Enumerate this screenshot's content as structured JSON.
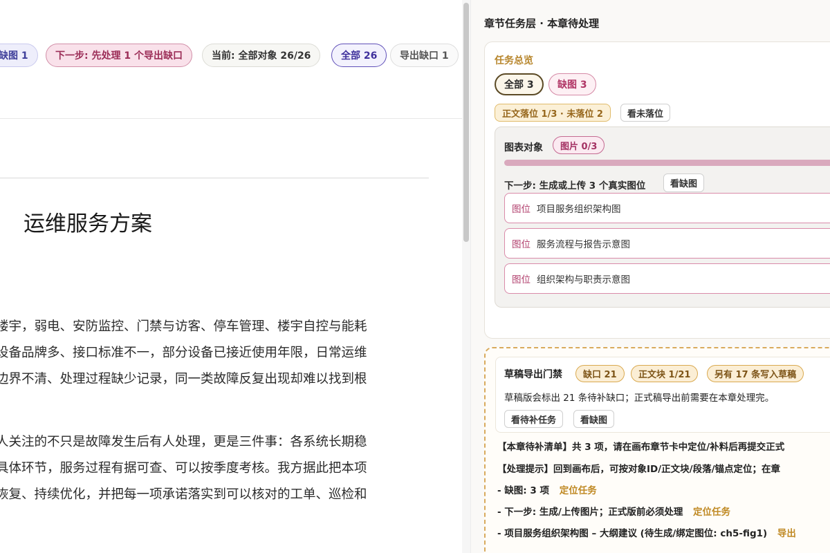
{
  "toolbar": {
    "missing_chip": "缺图 1",
    "next_step_chip": "下一步: 先处理 1 个导出缺口",
    "current_chip": "当前: 全部对象 26/26",
    "all_chip": "全部 26",
    "export_gap_chip": "导出缺口 1"
  },
  "document": {
    "title": "运维服务方案",
    "paragraph1": [
      "楼宇，弱电、安防监控、门禁与访客、停车管理、楼宇自控与能耗",
      "设备品牌多、接口标准不一，部分设备已接近使用年限，日常运维",
      "边界不清、处理过程缺少记录，同一类故障反复出现却难以找到根"
    ],
    "paragraph2": [
      "人关注的不只是故障发生后有人处理，更是三件事：各系统长期稳",
      "具体环节，服务过程有据可查、可以按季度考核。我方据此把本项",
      "恢复、持续优化，并把每一项承诺落实到可以核对的工单、巡检和"
    ]
  },
  "panel": {
    "title": "章节任务层 · 本章待处理",
    "overview": {
      "label": "任务总览",
      "all_pill": "全部  3",
      "missing_pill": "缺图  3",
      "placed_pill": "正文落位 1/3 · 未落位 2",
      "view_unplaced_button": "看未落位"
    },
    "chart_objects": {
      "label": "图表对象",
      "images_pill": "图片 0/3",
      "images_progress": 0,
      "next_step": "下一步: 生成或上传 3 个真实图位",
      "view_missing_button": "看缺图",
      "slots": [
        {
          "tag": "图位",
          "name": "项目服务组织架构图"
        },
        {
          "tag": "图位",
          "name": "服务流程与报告示意图"
        },
        {
          "tag": "图位",
          "name": "组织架构与职责示意图"
        }
      ]
    },
    "export_gate": {
      "label": "草稿导出门禁",
      "gap_badge": "缺口 21",
      "block_badge": "正文块 1/21",
      "extra_badge": "另有 17 条写入草稿",
      "description": "草稿版会标出 21 条待补缺口；正式稿导出前需要在本章处理完。",
      "pending_tasks_button": "看待补任务",
      "view_missing_button": "看缺图",
      "lines": [
        {
          "text": "【本章待补清单】共 3 项，请在画布章节卡中定位/补料后再提交正式",
          "link": ""
        },
        {
          "text": "【处理提示】回到画布后，可按对象ID/正文块/段落/锚点定位；在章",
          "link": ""
        },
        {
          "text": "- 缺图: 3 项",
          "link": "定位任务"
        },
        {
          "text": "- 下一步: 生成/上传图片；正式版前必须处理",
          "link": "定位任务"
        },
        {
          "text": "- 项目服务组织架构图 – 大纲建议 (待生成/绑定图位: ch5-fig1)",
          "link": "导出"
        }
      ]
    }
  }
}
